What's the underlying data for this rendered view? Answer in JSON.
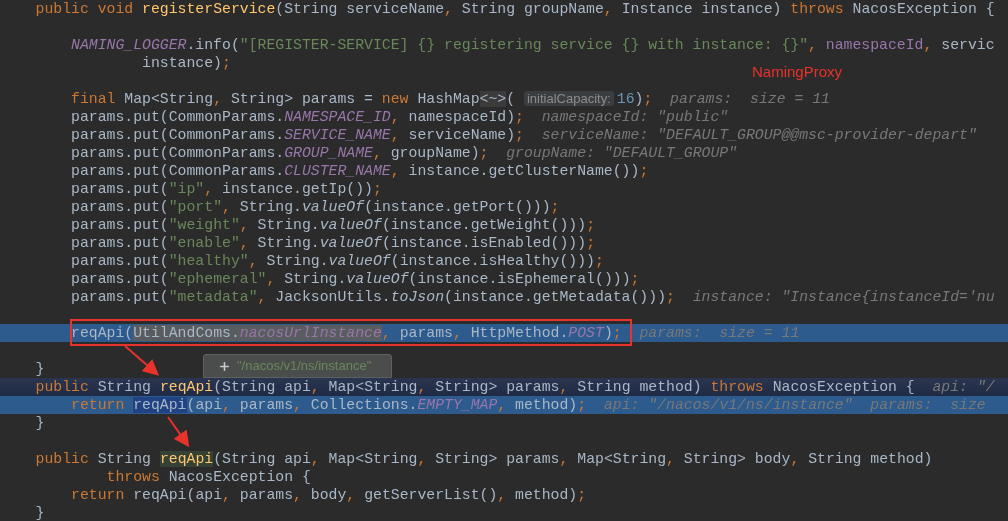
{
  "editor": {
    "lines": [
      {
        "kind": "code",
        "segments": [
          {
            "text": "    public void ",
            "kind": "keyword"
          },
          {
            "text": "registerService",
            "kind": "decl"
          },
          {
            "text": "(String serviceName",
            "kind": "plain"
          },
          {
            "text": ", ",
            "kind": "punct"
          },
          {
            "text": "String groupName",
            "kind": "plain"
          },
          {
            "text": ", ",
            "kind": "punct"
          },
          {
            "text": "Instance instance) ",
            "kind": "plain"
          },
          {
            "text": "throws ",
            "kind": "keyword"
          },
          {
            "text": "NacosException {",
            "kind": "plain"
          }
        ]
      },
      {
        "kind": "blank"
      },
      {
        "kind": "code",
        "segments": [
          {
            "text": "        NAMING_LOGGER",
            "kind": "constant"
          },
          {
            "text": ".info(",
            "kind": "plain"
          },
          {
            "text": "\"[REGISTER-SERVICE] {} registering service {} with instance: {}\"",
            "kind": "string"
          },
          {
            "text": ", ",
            "kind": "punct"
          },
          {
            "text": "namespaceId",
            "kind": "member"
          },
          {
            "text": ", ",
            "kind": "punct"
          },
          {
            "text": "servic",
            "kind": "plain"
          }
        ]
      },
      {
        "kind": "code",
        "segments": [
          {
            "text": "                instance)",
            "kind": "plain"
          },
          {
            "text": ";",
            "kind": "punct"
          }
        ]
      },
      {
        "kind": "blank"
      },
      {
        "kind": "code",
        "segments": [
          {
            "text": "        final ",
            "kind": "keyword"
          },
          {
            "text": "Map<String",
            "kind": "plain"
          },
          {
            "text": ", ",
            "kind": "punct"
          },
          {
            "text": "String> params = ",
            "kind": "plain"
          },
          {
            "text": "new ",
            "kind": "keyword"
          },
          {
            "text": "HashMap",
            "kind": "plain"
          },
          {
            "text": "<~>",
            "kind": "fold"
          },
          {
            "text": "( ",
            "kind": "plain"
          },
          {
            "text": "initialCapacity:",
            "kind": "inlay"
          },
          {
            "text": "16",
            "kind": "number"
          },
          {
            "text": ")",
            "kind": "plain"
          },
          {
            "text": ";",
            "kind": "punct"
          },
          {
            "text": "  params:  size = 11",
            "kind": "hint"
          }
        ]
      },
      {
        "kind": "code",
        "segments": [
          {
            "text": "        params.put(CommonParams.",
            "kind": "plain"
          },
          {
            "text": "NAMESPACE_ID",
            "kind": "constant"
          },
          {
            "text": ", ",
            "kind": "punct"
          },
          {
            "text": "namespaceId)",
            "kind": "plain"
          },
          {
            "text": ";",
            "kind": "punct"
          },
          {
            "text": "  namespaceId: \"public\"",
            "kind": "hint"
          }
        ]
      },
      {
        "kind": "code",
        "segments": [
          {
            "text": "        params.put(CommonParams.",
            "kind": "plain"
          },
          {
            "text": "SERVICE_NAME",
            "kind": "constant"
          },
          {
            "text": ", ",
            "kind": "punct"
          },
          {
            "text": "serviceName)",
            "kind": "plain"
          },
          {
            "text": ";",
            "kind": "punct"
          },
          {
            "text": "  serviceName: \"DEFAULT_GROUP@@msc-provider-depart\"",
            "kind": "hint"
          }
        ]
      },
      {
        "kind": "code",
        "segments": [
          {
            "text": "        params.put(CommonParams.",
            "kind": "plain"
          },
          {
            "text": "GROUP_NAME",
            "kind": "constant"
          },
          {
            "text": ", ",
            "kind": "punct"
          },
          {
            "text": "groupName)",
            "kind": "plain"
          },
          {
            "text": ";",
            "kind": "punct"
          },
          {
            "text": "  groupName: \"DEFAULT_GROUP\"",
            "kind": "hint"
          }
        ]
      },
      {
        "kind": "code",
        "segments": [
          {
            "text": "        params.put(CommonParams.",
            "kind": "plain"
          },
          {
            "text": "CLUSTER_NAME",
            "kind": "constant"
          },
          {
            "text": ", ",
            "kind": "punct"
          },
          {
            "text": "instance.getClusterName())",
            "kind": "plain"
          },
          {
            "text": ";",
            "kind": "punct"
          }
        ]
      },
      {
        "kind": "code",
        "segments": [
          {
            "text": "        params.put(",
            "kind": "plain"
          },
          {
            "text": "\"ip\"",
            "kind": "string"
          },
          {
            "text": ", ",
            "kind": "punct"
          },
          {
            "text": "instance.getIp())",
            "kind": "plain"
          },
          {
            "text": ";",
            "kind": "punct"
          }
        ]
      },
      {
        "kind": "code",
        "segments": [
          {
            "text": "        params.put(",
            "kind": "plain"
          },
          {
            "text": "\"port\"",
            "kind": "string"
          },
          {
            "text": ", ",
            "kind": "punct"
          },
          {
            "text": "String.",
            "kind": "plain"
          },
          {
            "text": "valueOf",
            "kind": "static"
          },
          {
            "text": "(instance.getPort()))",
            "kind": "plain"
          },
          {
            "text": ";",
            "kind": "punct"
          }
        ]
      },
      {
        "kind": "code",
        "segments": [
          {
            "text": "        params.put(",
            "kind": "plain"
          },
          {
            "text": "\"weight\"",
            "kind": "string"
          },
          {
            "text": ", ",
            "kind": "punct"
          },
          {
            "text": "String.",
            "kind": "plain"
          },
          {
            "text": "valueOf",
            "kind": "static"
          },
          {
            "text": "(instance.getWeight()))",
            "kind": "plain"
          },
          {
            "text": ";",
            "kind": "punct"
          }
        ]
      },
      {
        "kind": "code",
        "segments": [
          {
            "text": "        params.put(",
            "kind": "plain"
          },
          {
            "text": "\"enable\"",
            "kind": "string"
          },
          {
            "text": ", ",
            "kind": "punct"
          },
          {
            "text": "String.",
            "kind": "plain"
          },
          {
            "text": "valueOf",
            "kind": "static"
          },
          {
            "text": "(instance.isEnabled()))",
            "kind": "plain"
          },
          {
            "text": ";",
            "kind": "punct"
          }
        ]
      },
      {
        "kind": "code",
        "segments": [
          {
            "text": "        params.put(",
            "kind": "plain"
          },
          {
            "text": "\"healthy\"",
            "kind": "string"
          },
          {
            "text": ", ",
            "kind": "punct"
          },
          {
            "text": "String.",
            "kind": "plain"
          },
          {
            "text": "valueOf",
            "kind": "static"
          },
          {
            "text": "(instance.isHealthy()))",
            "kind": "plain"
          },
          {
            "text": ";",
            "kind": "punct"
          }
        ]
      },
      {
        "kind": "code",
        "segments": [
          {
            "text": "        params.put(",
            "kind": "plain"
          },
          {
            "text": "\"ephemeral\"",
            "kind": "string"
          },
          {
            "text": ", ",
            "kind": "punct"
          },
          {
            "text": "String.",
            "kind": "plain"
          },
          {
            "text": "valueOf",
            "kind": "static"
          },
          {
            "text": "(instance.isEphemeral()))",
            "kind": "plain"
          },
          {
            "text": ";",
            "kind": "punct"
          }
        ]
      },
      {
        "kind": "code",
        "segments": [
          {
            "text": "        params.put(",
            "kind": "plain"
          },
          {
            "text": "\"metadata\"",
            "kind": "string"
          },
          {
            "text": ", ",
            "kind": "punct"
          },
          {
            "text": "JacksonUtils.",
            "kind": "plain"
          },
          {
            "text": "toJson",
            "kind": "static"
          },
          {
            "text": "(instance.getMetadata()))",
            "kind": "plain"
          },
          {
            "text": ";",
            "kind": "punct"
          },
          {
            "text": "  instance: \"Instance{instanceId='nu",
            "kind": "hint"
          }
        ]
      },
      {
        "kind": "blank"
      },
      {
        "kind": "execution",
        "segments": [
          {
            "text": "        reqApi(",
            "kind": "plain"
          },
          {
            "text": "UtilAndComs.",
            "kind": "selected"
          },
          {
            "text": "nacosUrlInstance",
            "kind": "selected_constant"
          },
          {
            "text": ", ",
            "kind": "punct"
          },
          {
            "text": "params",
            "kind": "plain"
          },
          {
            "text": ", ",
            "kind": "punct"
          },
          {
            "text": "HttpMethod.",
            "kind": "plain"
          },
          {
            "text": "POST",
            "kind": "constant"
          },
          {
            "text": ")",
            "kind": "plain"
          },
          {
            "text": ";",
            "kind": "punct"
          },
          {
            "text": "  params:  size = 11",
            "kind": "hint"
          }
        ]
      },
      {
        "kind": "blank"
      },
      {
        "kind": "code",
        "segments": [
          {
            "text": "    }",
            "kind": "plain"
          }
        ]
      },
      {
        "kind": "frame",
        "segments": [
          {
            "text": "    public ",
            "kind": "keyword"
          },
          {
            "text": "String ",
            "kind": "plain"
          },
          {
            "text": "reqApi",
            "kind": "decl"
          },
          {
            "text": "(String api",
            "kind": "plain"
          },
          {
            "text": ", ",
            "kind": "punct"
          },
          {
            "text": "Map<String",
            "kind": "plain"
          },
          {
            "text": ", ",
            "kind": "punct"
          },
          {
            "text": "String> params",
            "kind": "plain"
          },
          {
            "text": ", ",
            "kind": "punct"
          },
          {
            "text": "String method) ",
            "kind": "plain"
          },
          {
            "text": "throws ",
            "kind": "keyword"
          },
          {
            "text": "NacosException {",
            "kind": "plain"
          },
          {
            "text": "  api: \"/",
            "kind": "hint"
          }
        ]
      },
      {
        "kind": "execution",
        "segments": [
          {
            "text": "        return ",
            "kind": "keyword"
          },
          {
            "text": "reqApi",
            "kind": "usage"
          },
          {
            "text": "(api",
            "kind": "plain"
          },
          {
            "text": ", ",
            "kind": "punct"
          },
          {
            "text": "params",
            "kind": "plain"
          },
          {
            "text": ", ",
            "kind": "punct"
          },
          {
            "text": "Collections.",
            "kind": "plain"
          },
          {
            "text": "EMPTY_MAP",
            "kind": "constant"
          },
          {
            "text": ", ",
            "kind": "punct"
          },
          {
            "text": "method)",
            "kind": "plain"
          },
          {
            "text": ";",
            "kind": "punct"
          },
          {
            "text": "  api: \"/nacos/v1/ns/instance\"  params:  size",
            "kind": "hint"
          }
        ]
      },
      {
        "kind": "code",
        "segments": [
          {
            "text": "    }",
            "kind": "plain"
          }
        ]
      },
      {
        "kind": "blank"
      },
      {
        "kind": "code",
        "segments": [
          {
            "text": "    public ",
            "kind": "keyword"
          },
          {
            "text": "String ",
            "kind": "plain"
          },
          {
            "text": "reqApi",
            "kind": "decl_usage"
          },
          {
            "text": "(String api",
            "kind": "plain"
          },
          {
            "text": ", ",
            "kind": "punct"
          },
          {
            "text": "Map<String",
            "kind": "plain"
          },
          {
            "text": ", ",
            "kind": "punct"
          },
          {
            "text": "String> params",
            "kind": "plain"
          },
          {
            "text": ", ",
            "kind": "punct"
          },
          {
            "text": "Map<String",
            "kind": "plain"
          },
          {
            "text": ", ",
            "kind": "punct"
          },
          {
            "text": "String> body",
            "kind": "plain"
          },
          {
            "text": ", ",
            "kind": "punct"
          },
          {
            "text": "String method)",
            "kind": "plain"
          }
        ]
      },
      {
        "kind": "code",
        "segments": [
          {
            "text": "            throws ",
            "kind": "keyword"
          },
          {
            "text": "NacosException {",
            "kind": "plain"
          }
        ]
      },
      {
        "kind": "code",
        "segments": [
          {
            "text": "        return ",
            "kind": "keyword"
          },
          {
            "text": "reqApi(api",
            "kind": "plain"
          },
          {
            "text": ", ",
            "kind": "punct"
          },
          {
            "text": "params",
            "kind": "plain"
          },
          {
            "text": ", ",
            "kind": "punct"
          },
          {
            "text": "body",
            "kind": "plain"
          },
          {
            "text": ", ",
            "kind": "punct"
          },
          {
            "text": "getServerList()",
            "kind": "plain"
          },
          {
            "text": ", ",
            "kind": "punct"
          },
          {
            "text": "method)",
            "kind": "plain"
          },
          {
            "text": ";",
            "kind": "punct"
          }
        ]
      },
      {
        "kind": "code",
        "segments": [
          {
            "text": "    }",
            "kind": "plain"
          }
        ]
      }
    ]
  },
  "annotations": {
    "label": "NamingProxy",
    "tooltip": "\"/nacos/v1/ns/instance\""
  }
}
